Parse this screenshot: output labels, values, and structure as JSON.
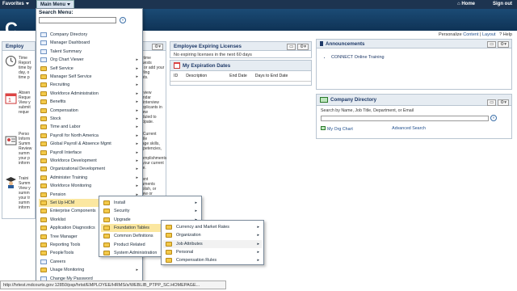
{
  "topbar": {
    "favorites": "Favorites",
    "main_menu": "Main Menu",
    "home": "Home",
    "sign_out": "Sign out"
  },
  "banner": {
    "logo_letter": "C"
  },
  "persbar": {
    "personalize": "Personalize",
    "content": "Content",
    "sep": "|",
    "layout": "Layout",
    "help": "Help"
  },
  "menu": {
    "title": "Search Menu:",
    "go": "»",
    "items": [
      {
        "label": "Company Directory",
        "icon": "page",
        "arrow": false
      },
      {
        "label": "Manager Dashboard",
        "icon": "page",
        "arrow": false
      },
      {
        "label": "Talent Summary",
        "icon": "page",
        "arrow": false
      },
      {
        "label": "Org Chart Viewer",
        "icon": "page",
        "arrow": true
      },
      {
        "label": "Self Service",
        "icon": "folder",
        "arrow": true
      },
      {
        "label": "Manager Self Service",
        "icon": "folder",
        "arrow": true
      },
      {
        "label": "Recruiting",
        "icon": "folder",
        "arrow": true
      },
      {
        "label": "Workforce Administration",
        "icon": "folder",
        "arrow": true
      },
      {
        "label": "Benefits",
        "icon": "folder",
        "arrow": true
      },
      {
        "label": "Compensation",
        "icon": "folder",
        "arrow": true
      },
      {
        "label": "Stock",
        "icon": "folder",
        "arrow": true
      },
      {
        "label": "Time and Labor",
        "icon": "folder",
        "arrow": true
      },
      {
        "label": "Payroll for North America",
        "icon": "folder",
        "arrow": true
      },
      {
        "label": "Global Payroll & Absence Mgmt",
        "icon": "folder",
        "arrow": true
      },
      {
        "label": "Payroll Interface",
        "icon": "folder",
        "arrow": true
      },
      {
        "label": "Workforce Development",
        "icon": "folder",
        "arrow": true
      },
      {
        "label": "Organizational Development",
        "icon": "folder",
        "arrow": true
      },
      {
        "label": "Administer Training",
        "icon": "folder",
        "arrow": true
      },
      {
        "label": "Workforce Monitoring",
        "icon": "folder",
        "arrow": true
      },
      {
        "label": "Pension",
        "icon": "folder",
        "arrow": true
      },
      {
        "label": "Set Up HCM",
        "icon": "folder",
        "arrow": true
      },
      {
        "label": "Enterprise Components",
        "icon": "folder",
        "arrow": true
      },
      {
        "label": "Worklist",
        "icon": "folder",
        "arrow": true
      },
      {
        "label": "Application Diagnostics",
        "icon": "folder",
        "arrow": true
      },
      {
        "label": "Tree Manager",
        "icon": "folder",
        "arrow": true
      },
      {
        "label": "Reporting Tools",
        "icon": "folder",
        "arrow": true
      },
      {
        "label": "PeopleTools",
        "icon": "folder",
        "arrow": true
      },
      {
        "label": "Careers",
        "icon": "page",
        "arrow": false
      },
      {
        "label": "Usage Monitoring",
        "icon": "folder",
        "arrow": true
      },
      {
        "label": "Change My Password",
        "icon": "page",
        "arrow": false
      }
    ]
  },
  "sub1": {
    "items": [
      {
        "label": "Install",
        "arrow": true
      },
      {
        "label": "Security",
        "arrow": true
      },
      {
        "label": "Upgrade",
        "arrow": true
      },
      {
        "label": "Foundation Tables",
        "arrow": true
      },
      {
        "label": "Common Definitions",
        "arrow": true
      },
      {
        "label": "Product Related",
        "arrow": true
      },
      {
        "label": "System Administration",
        "arrow": true
      }
    ]
  },
  "sub2": {
    "items": [
      {
        "label": "Currency and Market Rates",
        "arrow": true
      },
      {
        "label": "Organization",
        "arrow": true
      },
      {
        "label": "Job Attributes",
        "arrow": true
      },
      {
        "label": "Personal",
        "arrow": true
      },
      {
        "label": "Compensation Rules",
        "arrow": true
      }
    ]
  },
  "emp_lic": {
    "title": "Employee Expiring Licenses",
    "body": "No expiring licenses in the next 60 days"
  },
  "myexp": {
    "title": "My Expiration Dates",
    "cols": [
      "ID",
      "Description",
      "End Date",
      "Days to End Date"
    ]
  },
  "announce": {
    "title": "Announcements",
    "items": [
      "CONNECT Online Training"
    ]
  },
  "compdir": {
    "title": "Company Directory",
    "hint": "Search by Name, Job Title, Department, or Email",
    "org_chart": "My Org Chart",
    "adv_search": "Advanced Search"
  },
  "left_pg": {
    "title_frag": "Employ",
    "frags": [
      {
        "t": "Time\nReport\ntime by\nday, o\ntime p"
      },
      {
        "t": "Absen\nReque\nView y\nsubmit\nreque"
      },
      {
        "t": "Perso\nInform\nSumm\nReview\nsumm\nyour p\ninform"
      },
      {
        "t": "Traini\nSumm\nView y\nsumm\nyour tr\nsumm\ninform"
      }
    ]
  },
  "mid_pg": {
    "frags": [
      {
        "t": "ertime\nquests\nw or add your\narling\nests."
      },
      {
        "t": "review\nlendar\ne interview\napplicants in\nview\neduled to\nticipate."
      },
      {
        "t": "y Current\nofile\nnage skills,\nmpetencies,\nd\ncomplishments\nr your current\nfile."
      },
      {
        "t": "rrent\ncuments\nablish, or\nview or\nd"
      }
    ]
  },
  "status": {
    "url": "http://hrtest.mdcourts.gov:12850/psp/hrtst/EMPLOYEE/HRMS/s/WEBLIB_PTPP_SC.HOMEPAGE..."
  }
}
